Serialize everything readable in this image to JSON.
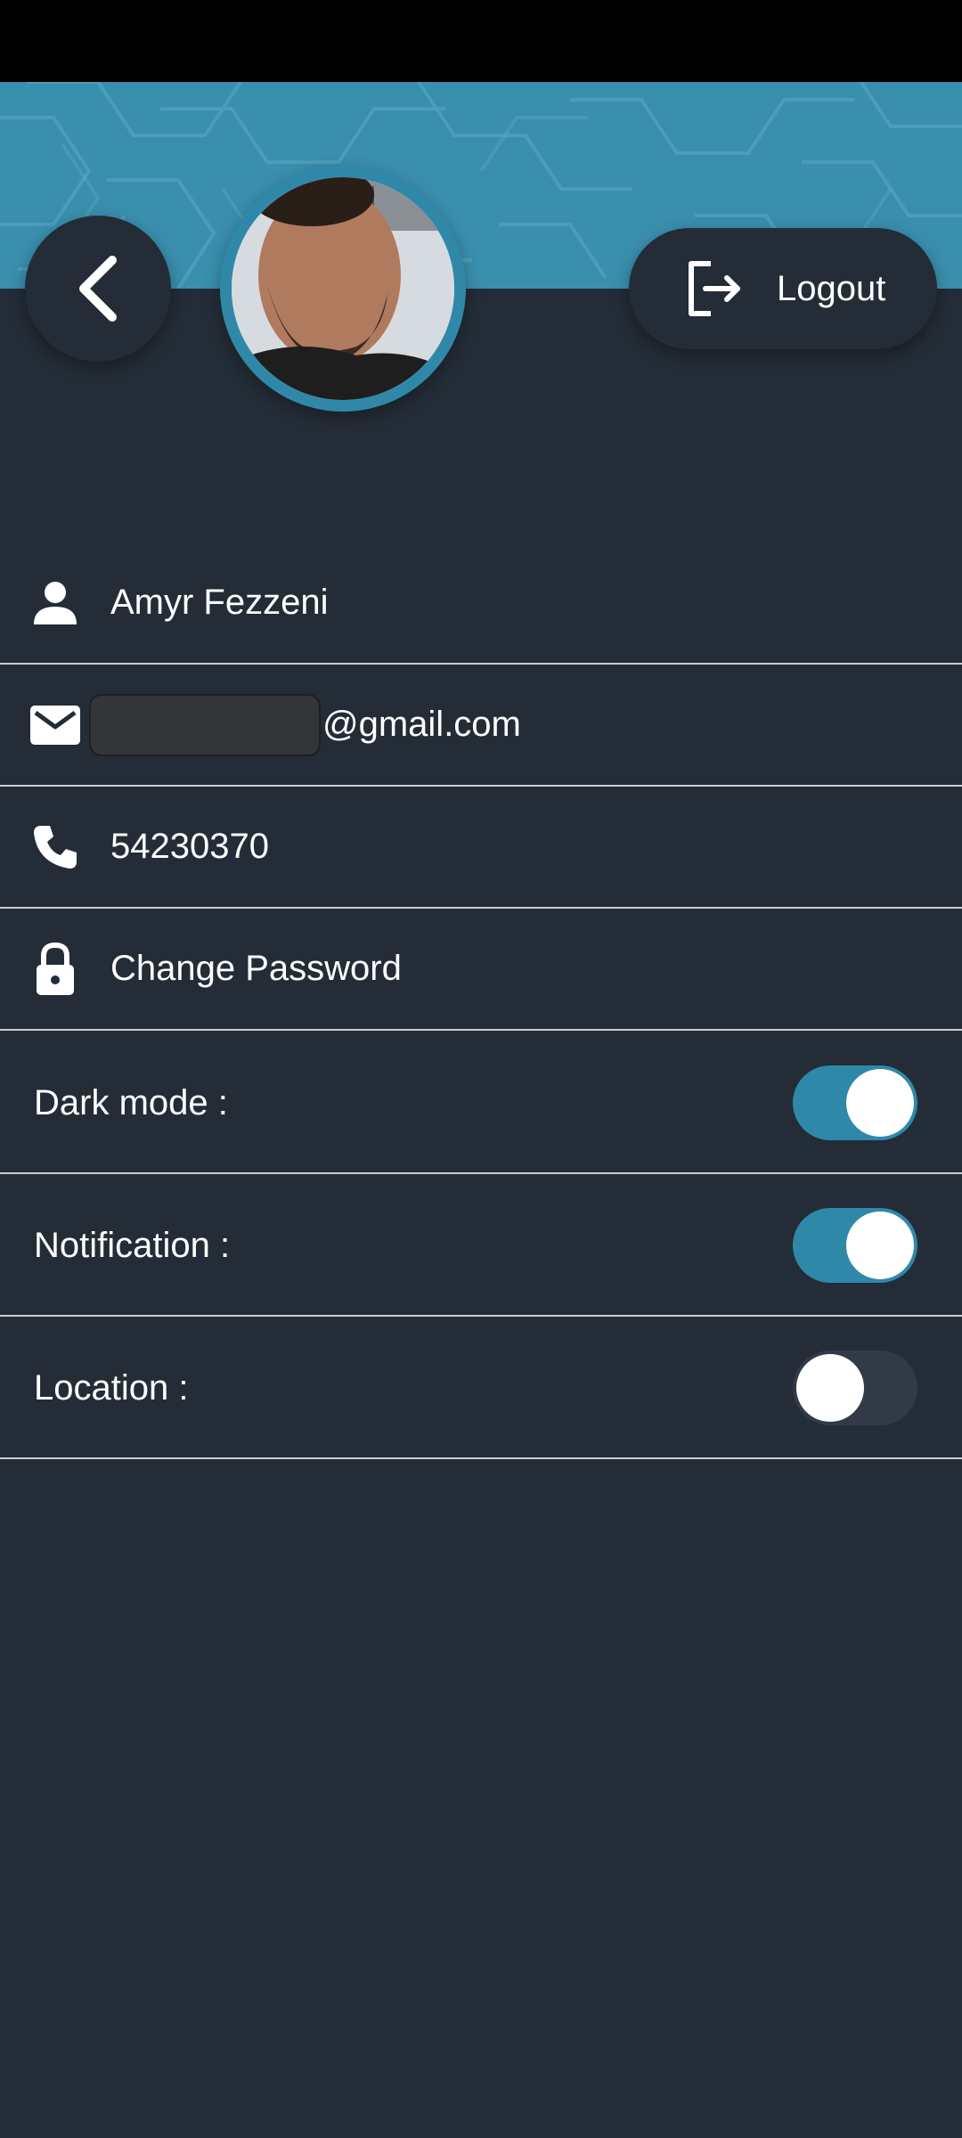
{
  "header": {
    "logout_label": "Logout",
    "accent_color": "#3a8fae",
    "back_icon": "chevron-left-icon",
    "logout_icon": "logout-icon"
  },
  "profile": {
    "name": "Amyr Fezzeni",
    "email_domain": "@gmail.com",
    "phone": "54230370",
    "change_password": "Change Password"
  },
  "settings": [
    {
      "label": "Dark mode :",
      "enabled": true
    },
    {
      "label": "Notification :",
      "enabled": true
    },
    {
      "label": "Location :",
      "enabled": false
    }
  ],
  "colors": {
    "background": "#232c37",
    "toggle_on": "#2f88a8",
    "toggle_off": "#313a46"
  }
}
